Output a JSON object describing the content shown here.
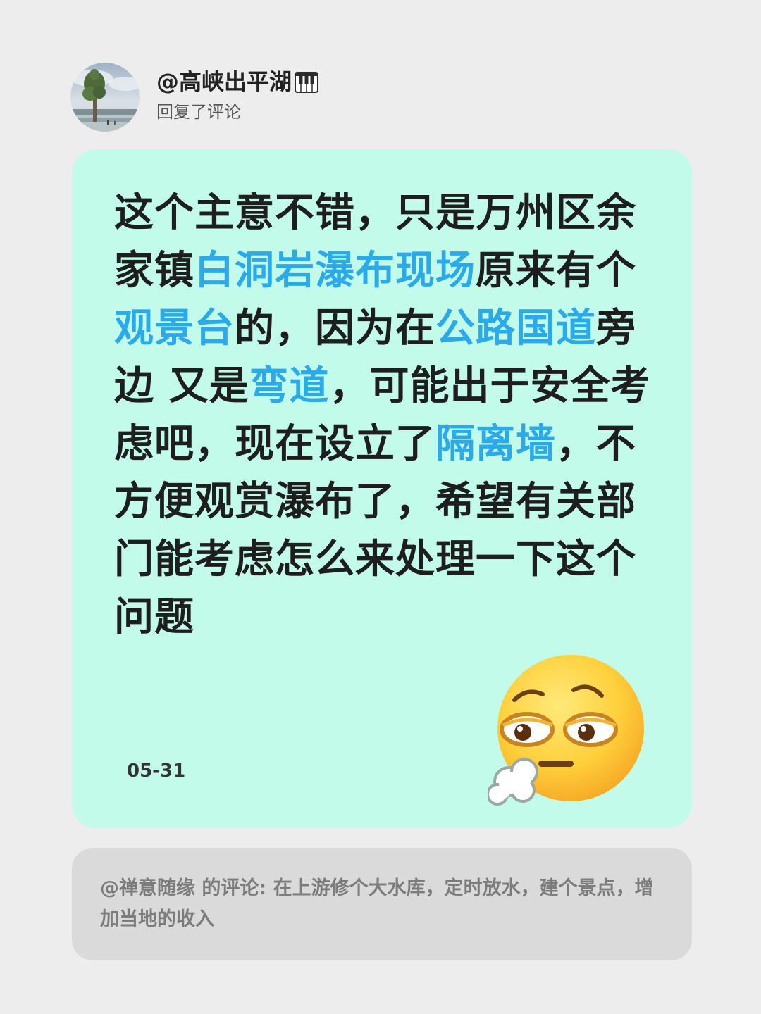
{
  "user": {
    "name": "@高峡出平湖",
    "action": "回复了评论",
    "name_emoji": "piano-icon"
  },
  "reply": {
    "segments": [
      {
        "text": "这个主意不错，只是万州区余家镇",
        "highlight": false
      },
      {
        "text": "白洞岩瀑布现场",
        "highlight": true
      },
      {
        "text": "原来有个",
        "highlight": false
      },
      {
        "text": "观景台",
        "highlight": true
      },
      {
        "text": "的，因为在",
        "highlight": false
      },
      {
        "text": "公路国道",
        "highlight": true
      },
      {
        "text": "旁边 又是",
        "highlight": false
      },
      {
        "text": "弯道",
        "highlight": true
      },
      {
        "text": "，可能出于安全考虑吧，现在设立了",
        "highlight": false
      },
      {
        "text": "隔离墙",
        "highlight": true
      },
      {
        "text": "，不方便观赏瀑布了，希望有关部门能考虑怎么来处理一下这个问题",
        "highlight": false
      }
    ],
    "date": "05-31",
    "emoji": "face-exhaling-icon"
  },
  "quote": {
    "text": "@禅意随缘 的评论: 在上游修个大水库，定时放水，建个景点，增加当地的收入"
  },
  "colors": {
    "page_bg": "#ededed",
    "reply_bg": "#c2fbe9",
    "highlight": "#2aa9eb",
    "quote_bg": "#dadada",
    "quote_text": "#7c7c7c"
  }
}
